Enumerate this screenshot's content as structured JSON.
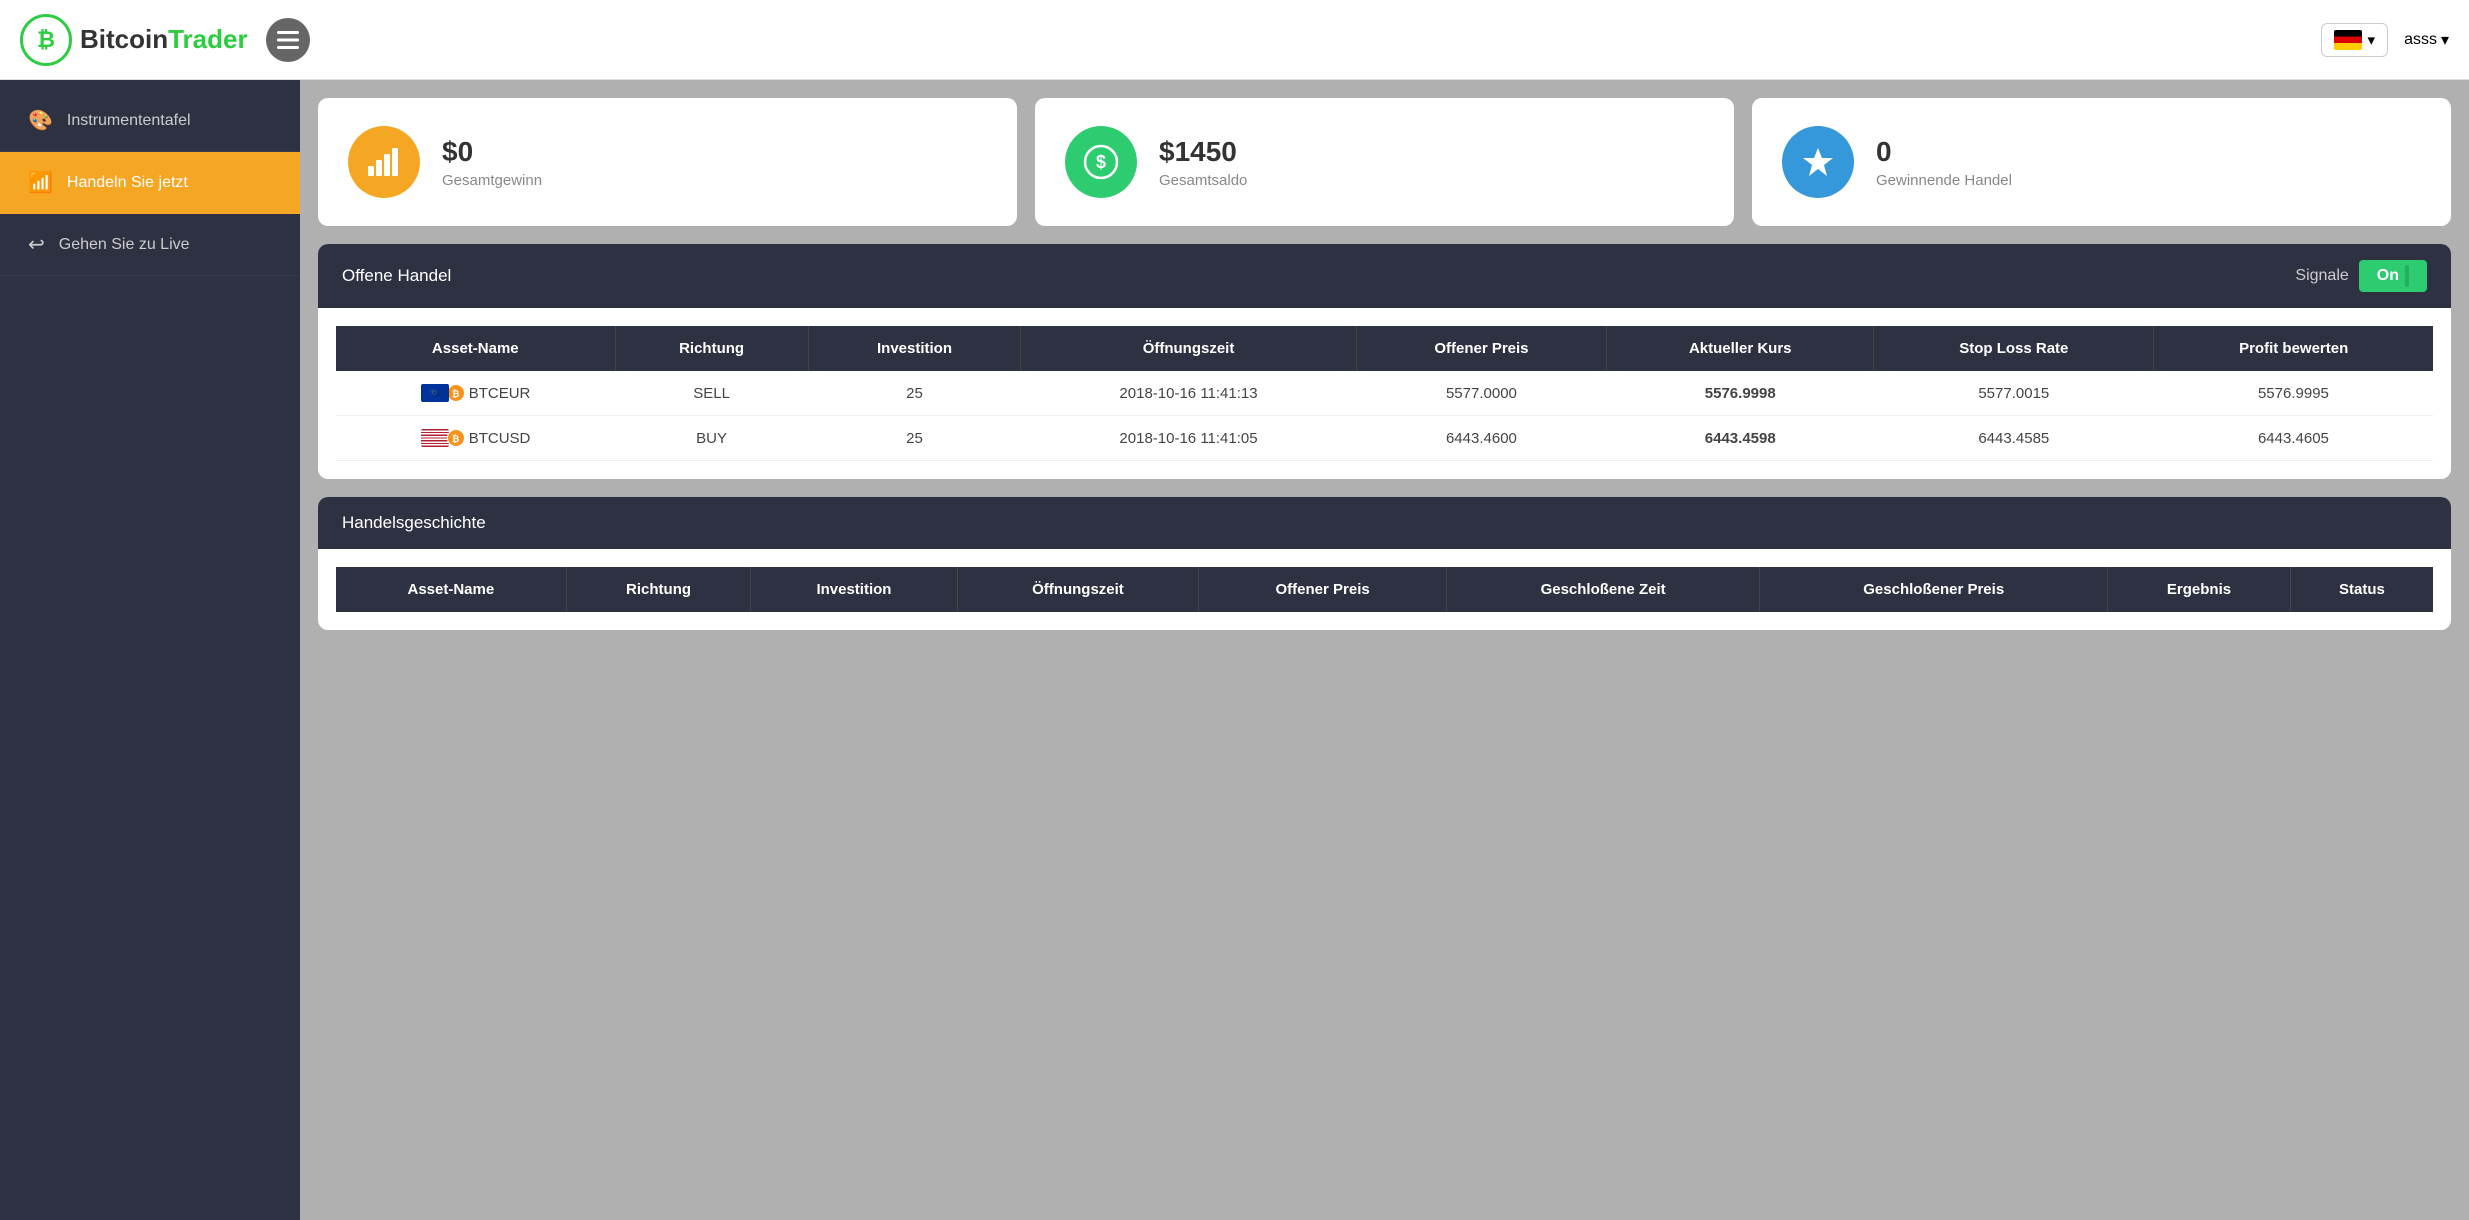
{
  "header": {
    "logo_bitcoin": "Bitcoin",
    "logo_trader": "Trader",
    "logo_symbol": "₿",
    "user_name": "asss",
    "lang_chevron": "▾"
  },
  "sidebar": {
    "items": [
      {
        "id": "dashboard",
        "label": "Instrumententafel",
        "icon": "🎨",
        "active": false
      },
      {
        "id": "trade",
        "label": "Handeln Sie jetzt",
        "icon": "📶",
        "active": true
      },
      {
        "id": "live",
        "label": "Gehen Sie zu Live",
        "icon": "↩",
        "active": false
      }
    ]
  },
  "stats": [
    {
      "id": "profit",
      "value": "$0",
      "label": "Gesamtgewinn",
      "icon_type": "yellow",
      "icon": "📊"
    },
    {
      "id": "balance",
      "value": "$1450",
      "label": "Gesamtsaldo",
      "icon_type": "green",
      "icon": "💵"
    },
    {
      "id": "trades",
      "value": "0",
      "label": "Gewinnende Handel",
      "icon_type": "blue",
      "icon": "🏆"
    }
  ],
  "open_trades": {
    "title": "Offene Handel",
    "signals_label": "Signale",
    "toggle_state": "On",
    "columns": [
      "Asset-Name",
      "Richtung",
      "Investition",
      "Öffnungszeit",
      "Offener Preis",
      "Aktueller Kurs",
      "Stop Loss Rate",
      "Profit bewerten"
    ],
    "rows": [
      {
        "asset": "BTCEUR",
        "flag": "eu",
        "direction": "SELL",
        "investment": "25",
        "open_time": "2018-10-16 11:41:13",
        "open_price": "5577.0000",
        "current_rate": "5576.9998",
        "stop_loss": "5577.0015",
        "profit": "5576.9995"
      },
      {
        "asset": "BTCUSD",
        "flag": "us",
        "direction": "BUY",
        "investment": "25",
        "open_time": "2018-10-16 11:41:05",
        "open_price": "6443.4600",
        "current_rate": "6443.4598",
        "stop_loss": "6443.4585",
        "profit": "6443.4605"
      }
    ]
  },
  "trade_history": {
    "title": "Handelsgeschichte",
    "columns": [
      "Asset-Name",
      "Richtung",
      "Investition",
      "Öffnungszeit",
      "Offener Preis",
      "Geschloßene Zeit",
      "Geschloßener Preis",
      "Ergebnis",
      "Status"
    ]
  }
}
